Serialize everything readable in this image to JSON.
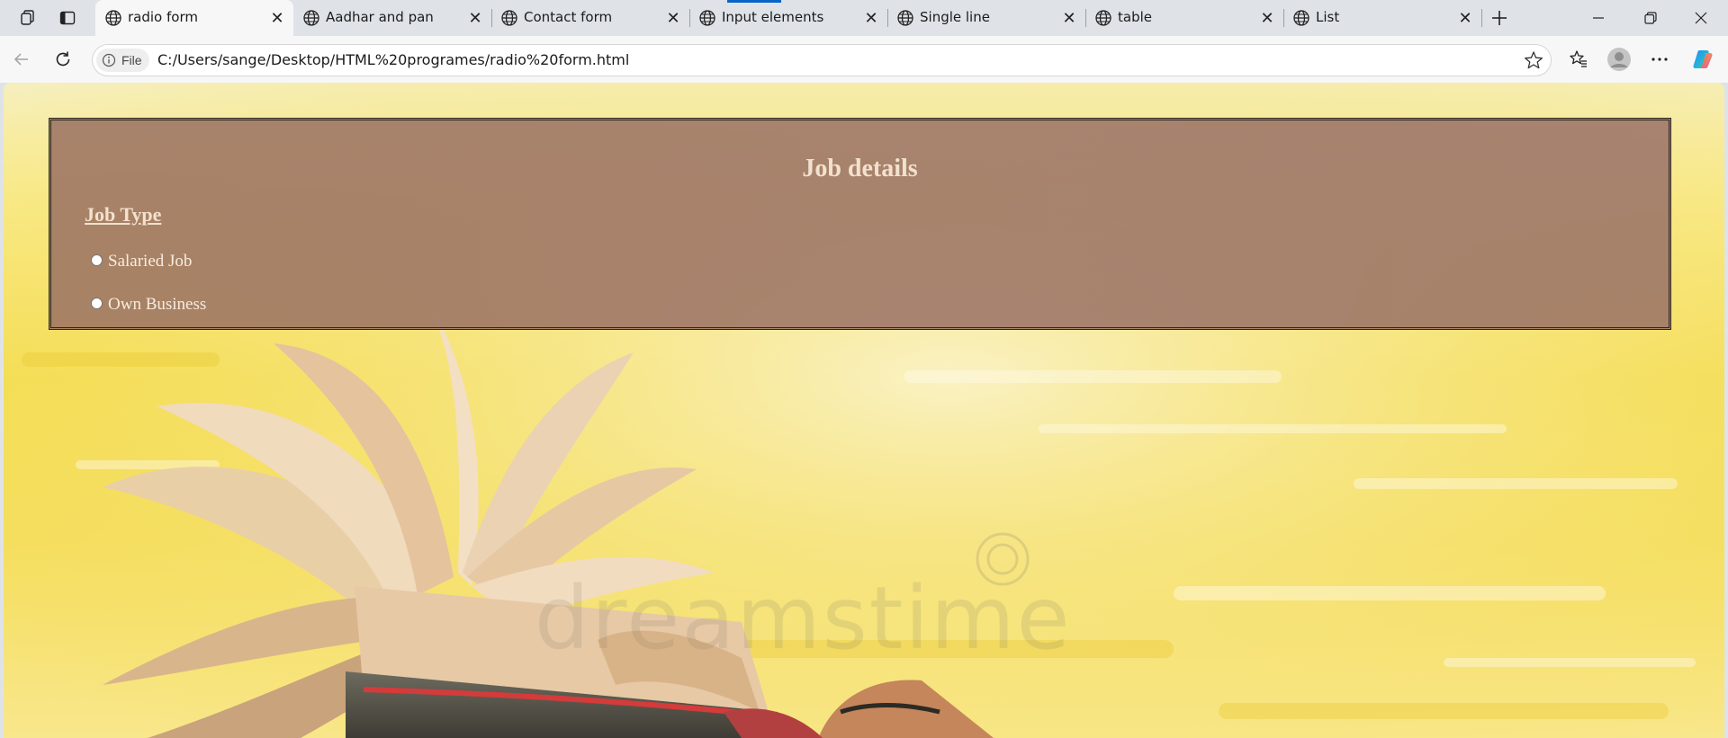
{
  "browser": {
    "tabs": [
      {
        "title": "radio form",
        "active": true
      },
      {
        "title": "Aadhar and pan",
        "active": false
      },
      {
        "title": "Contact form",
        "active": false
      },
      {
        "title": "Input elements",
        "active": false
      },
      {
        "title": "Single line",
        "active": false
      },
      {
        "title": "table",
        "active": false
      },
      {
        "title": "List",
        "active": false
      }
    ],
    "address": {
      "site_info_label": "File",
      "url": "C:/Users/sange/Desktop/HTML%20programes/radio%20form.html"
    },
    "icons": {
      "workspaces": "workspaces-icon",
      "vertical_tabs": "vertical-tabs-icon",
      "tab_favicon": "globe-icon",
      "new_tab": "plus-icon",
      "minimize": "minimize-icon",
      "restore": "restore-icon",
      "close": "close-icon",
      "back": "back-arrow-icon",
      "refresh": "refresh-icon",
      "favorite": "star-icon",
      "favorites": "favorites-icon",
      "profile": "avatar-icon",
      "menu": "more-icon",
      "copilot": "copilot-icon"
    },
    "colors": {
      "tabstrip": "#dfe3e8",
      "toolbar": "#f7f7f7",
      "accent": "#0a64c8"
    }
  },
  "page": {
    "title": "Job details",
    "section_label": "Job Type",
    "options": [
      {
        "label": "Salaried Job",
        "checked": false
      },
      {
        "label": "Own Business",
        "checked": false
      }
    ],
    "watermark": "dreamstime",
    "colors": {
      "form_background": "#96705f",
      "text": "#f2e1cf",
      "page_background": "#f4dd52"
    }
  }
}
